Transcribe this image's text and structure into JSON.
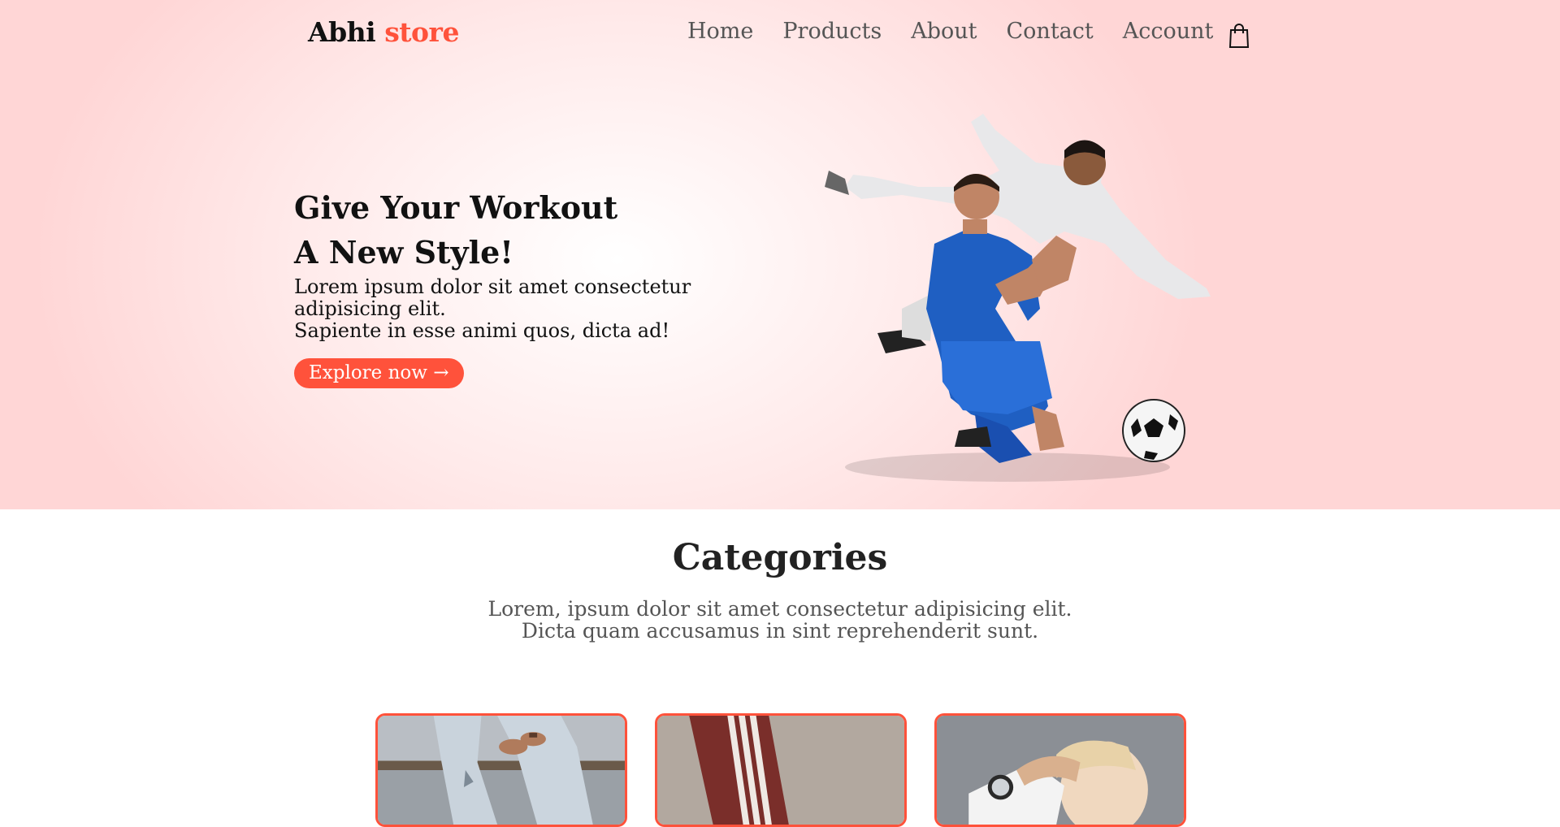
{
  "navbar": {
    "logo_main": "Abhi",
    "logo_accent": "store",
    "links": [
      "Home",
      "Products",
      "About",
      "Contact",
      "Account"
    ],
    "cart_icon": "shopping-bag-icon"
  },
  "hero": {
    "title_line1": "Give Your Workout",
    "title_line2": "A New Style!",
    "desc_line1": "Lorem ipsum dolor sit amet consectetur adipisicing elit.",
    "desc_line2": "Sapiente in esse animi quos, dicta ad!",
    "button_label": "Explore now →",
    "image": "football-players-photo"
  },
  "categories": {
    "title": "Categories",
    "desc_line1": "Lorem, ipsum dolor sit amet consectetur adipisicing elit.",
    "desc_line2": "Dicta quam accusamus in sint reprehenderit sunt.",
    "cards": [
      "category-jeans-photo",
      "category-trackpants-photo",
      "category-smartwatch-photo"
    ]
  },
  "colors": {
    "accent": "#ff523b",
    "hero_bg": "#ffd6d6"
  }
}
